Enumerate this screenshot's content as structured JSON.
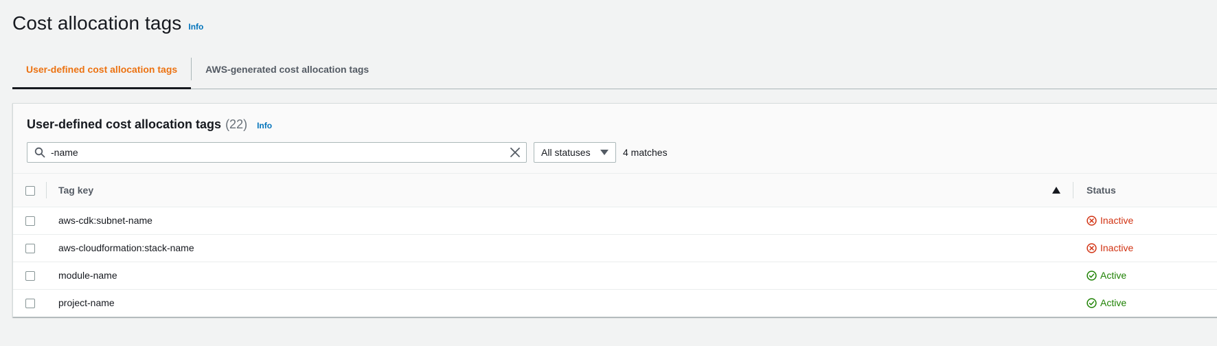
{
  "page": {
    "title": "Cost allocation tags",
    "info_label": "Info"
  },
  "tabs": [
    {
      "label": "User-defined cost allocation tags",
      "active": true
    },
    {
      "label": "AWS-generated cost allocation tags",
      "active": false
    }
  ],
  "panel": {
    "title": "User-defined cost allocation tags",
    "count": "(22)",
    "info_label": "Info",
    "search": {
      "value": "-name",
      "icon": "search-icon"
    },
    "status_filter": {
      "selected": "All statuses"
    },
    "matches": "4 matches",
    "table": {
      "columns": [
        "Tag key",
        "Status"
      ],
      "rows": [
        {
          "key": "aws-cdk:subnet-name",
          "status": "Inactive"
        },
        {
          "key": "aws-cloudformation:stack-name",
          "status": "Inactive"
        },
        {
          "key": "module-name",
          "status": "Active"
        },
        {
          "key": "project-name",
          "status": "Active"
        }
      ]
    }
  },
  "colors": {
    "active_tab": "#ec7211",
    "link": "#0073bb",
    "inactive": "#d13212",
    "active": "#1d8102"
  }
}
